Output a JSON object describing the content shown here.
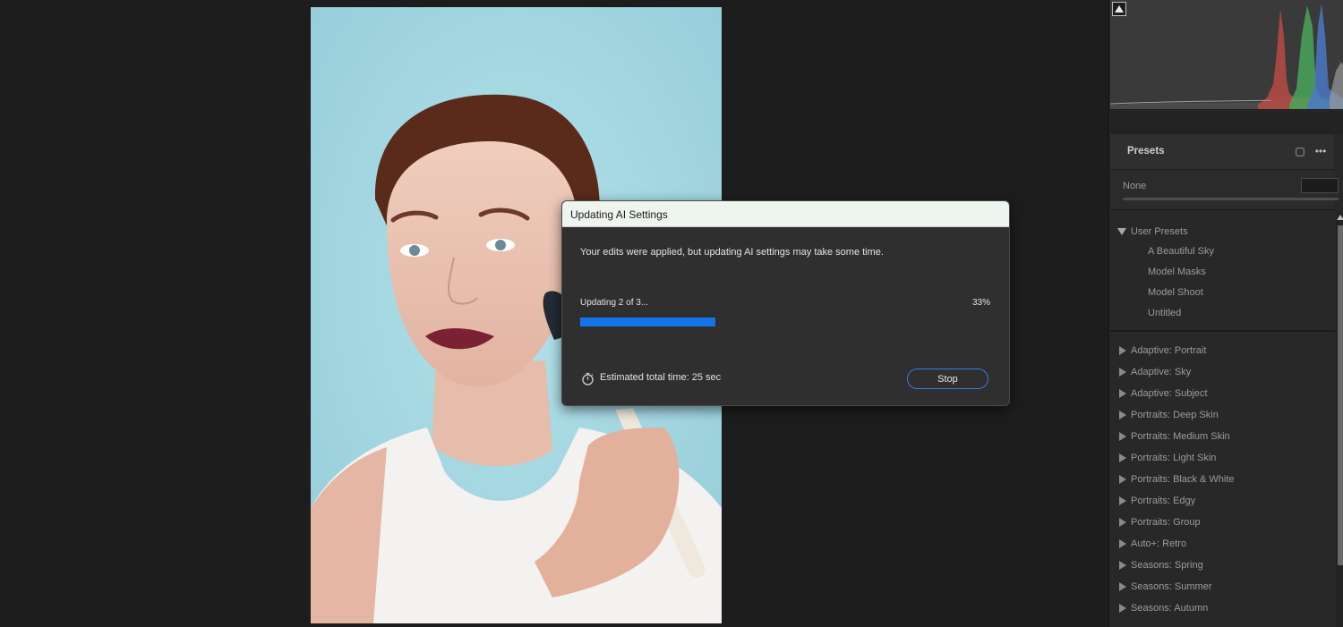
{
  "photo": {
    "subject": "portrait-photo"
  },
  "histogram": {
    "clipping_icon": "shadow-clipping-triangle-icon"
  },
  "presets": {
    "title": "Presets",
    "header_icons": [
      "new-preset-icon",
      "more-options-icon"
    ],
    "amount_label": "None",
    "user_group": {
      "label": "User Presets",
      "expanded": true,
      "items": [
        "A Beautiful Sky",
        "Model Masks",
        "Model Shoot",
        "Untitled"
      ]
    },
    "groups": [
      "Adaptive: Portrait",
      "Adaptive: Sky",
      "Adaptive: Subject",
      "Portraits: Deep Skin",
      "Portraits: Medium Skin",
      "Portraits: Light Skin",
      "Portraits: Black & White",
      "Portraits: Edgy",
      "Portraits: Group",
      "Auto+: Retro",
      "Seasons: Spring",
      "Seasons: Summer",
      "Seasons: Autumn"
    ]
  },
  "dialog": {
    "title": "Updating AI Settings",
    "message": "Your edits were applied, but updating AI settings may take some time.",
    "progress_label": "Updating 2 of 3...",
    "progress_percent_text": "33%",
    "progress_fraction": 0.33,
    "estimate": "Estimated total time: 25 sec",
    "stop_label": "Stop",
    "accent_color": "#1473e6"
  }
}
